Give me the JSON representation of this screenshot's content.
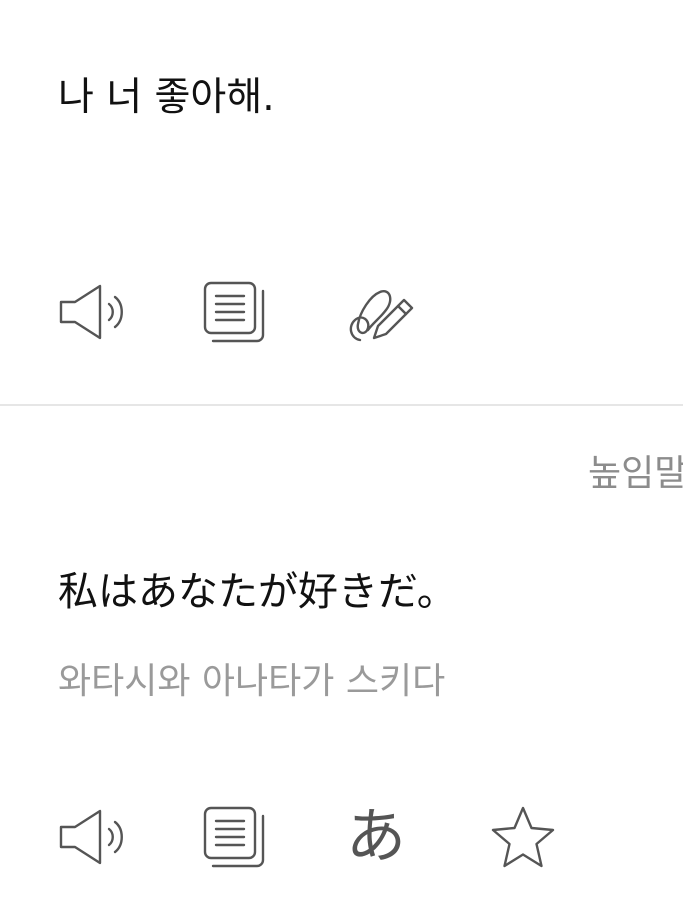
{
  "source": {
    "text": "나 너 좋아해."
  },
  "target": {
    "formality": "높임말",
    "text": "私はあなたが好きだ。",
    "pronunciation": "와타시와 아나타가 스키다",
    "kana_button_glyph": "あ"
  },
  "icons": {
    "source_speak": "speaker-icon",
    "source_copy": "copy-icon",
    "source_handwrite": "handwriting-pen-icon",
    "target_speak": "speaker-icon",
    "target_copy": "copy-icon",
    "target_kana": "kana-toggle-icon",
    "target_favorite": "star-icon"
  },
  "colors": {
    "text_primary": "#111111",
    "text_secondary": "#9a9a9a",
    "icon": "#555555",
    "divider": "#e6e6e6"
  }
}
